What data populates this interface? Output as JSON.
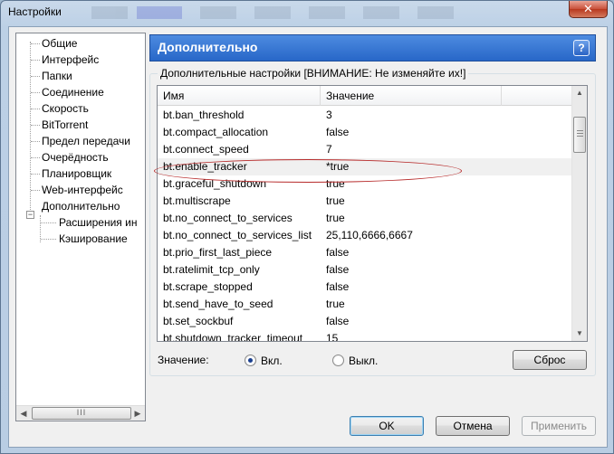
{
  "window": {
    "title": "Настройки",
    "close_label": "✕"
  },
  "sidebar": {
    "items": [
      {
        "label": "Общие"
      },
      {
        "label": "Интерфейс"
      },
      {
        "label": "Папки"
      },
      {
        "label": "Соединение"
      },
      {
        "label": "Скорость"
      },
      {
        "label": "BitTorrent"
      },
      {
        "label": "Предел передачи"
      },
      {
        "label": "Очерёдность"
      },
      {
        "label": "Планировщик"
      },
      {
        "label": "Web-интерфейс"
      },
      {
        "label": "Дополнительно",
        "expander": "−",
        "selected": true
      },
      {
        "label": "Расширения ин",
        "child": true
      },
      {
        "label": "Кэширование",
        "child": true
      }
    ],
    "hscroll_grip": "III"
  },
  "panel": {
    "title": "Дополнительно",
    "help_label": "?",
    "group_label": "Дополнительные настройки [ВНИМАНИЕ: Не изменяйте их!]",
    "columns": {
      "name": "Имя",
      "value": "Значение"
    },
    "rows": [
      {
        "name": "bt.ban_threshold",
        "value": "3"
      },
      {
        "name": "bt.compact_allocation",
        "value": "false"
      },
      {
        "name": "bt.connect_speed",
        "value": "7"
      },
      {
        "name": "bt.enable_tracker",
        "value": "*true",
        "selected": true
      },
      {
        "name": "bt.graceful_shutdown",
        "value": "true"
      },
      {
        "name": "bt.multiscrape",
        "value": "true"
      },
      {
        "name": "bt.no_connect_to_services",
        "value": "true"
      },
      {
        "name": "bt.no_connect_to_services_list",
        "value": "25,110,6666,6667"
      },
      {
        "name": "bt.prio_first_last_piece",
        "value": "false"
      },
      {
        "name": "bt.ratelimit_tcp_only",
        "value": "false"
      },
      {
        "name": "bt.scrape_stopped",
        "value": "false"
      },
      {
        "name": "bt.send_have_to_seed",
        "value": "true"
      },
      {
        "name": "bt.set_sockbuf",
        "value": "false"
      },
      {
        "name": "bt.shutdown_tracker_timeout",
        "value": "15"
      }
    ],
    "value_label": "Значение:",
    "radio_on": "Вкл.",
    "radio_off": "Выкл.",
    "radio_selected": "on",
    "reset_label": "Сброс"
  },
  "footer": {
    "ok_label": "OK",
    "cancel_label": "Отмена",
    "apply_label": "Применить"
  },
  "colors": {
    "header_blue": "#2a69c9",
    "highlight_red": "#b72b2b"
  }
}
